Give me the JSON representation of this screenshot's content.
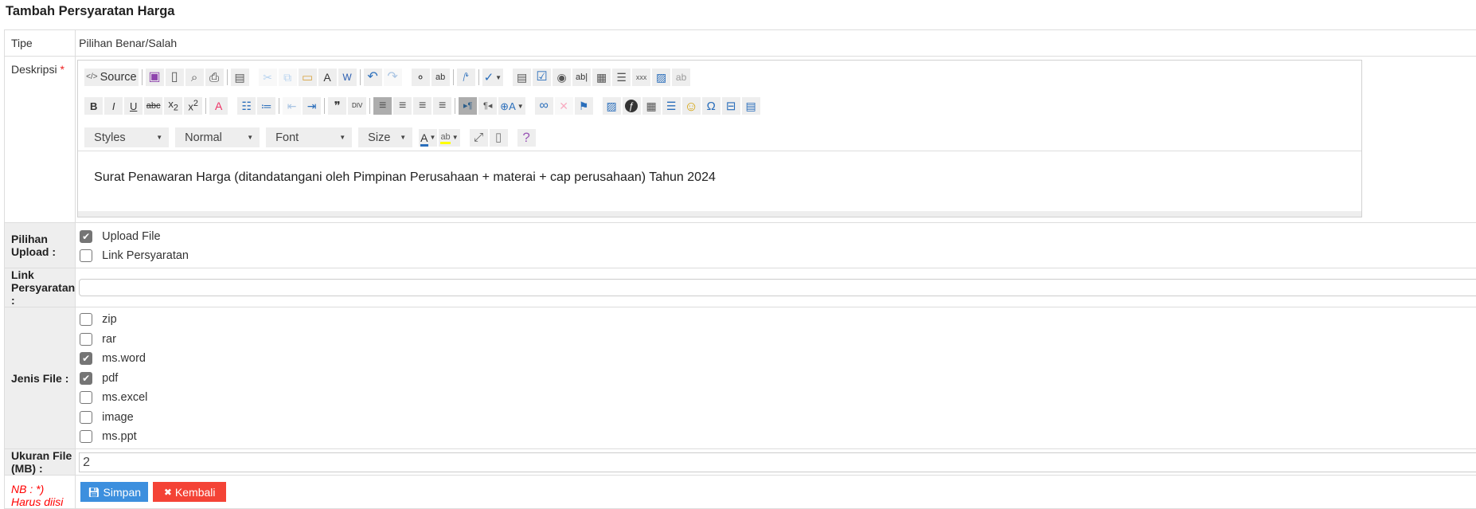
{
  "title": "Tambah Persyaratan Harga",
  "rows": {
    "tipe": {
      "label": "Tipe",
      "value": "Pilihan Benar/Salah"
    },
    "deskripsi": {
      "label": "Deskripsi",
      "required_mark": "*"
    },
    "pilihan_upload": {
      "label": "Pilihan Upload :",
      "options": [
        {
          "label": "Upload File",
          "checked": true
        },
        {
          "label": "Link Persyaratan",
          "checked": false
        }
      ]
    },
    "link_persyaratan": {
      "label": "Link Persyaratan :",
      "selected": ""
    },
    "jenis_file": {
      "label": "Jenis File :",
      "options": [
        {
          "label": "zip",
          "checked": false
        },
        {
          "label": "rar",
          "checked": false
        },
        {
          "label": "ms.word",
          "checked": true
        },
        {
          "label": "pdf",
          "checked": true
        },
        {
          "label": "ms.excel",
          "checked": false
        },
        {
          "label": "image",
          "checked": false
        },
        {
          "label": "ms.ppt",
          "checked": false
        }
      ]
    },
    "ukuran_file": {
      "label": "Ukuran File (MB) :",
      "value": "2"
    },
    "note": "NB : *) Harus diisi"
  },
  "editor": {
    "content": "Surat Penawaran Harga (ditandatangani oleh Pimpinan Perusahaan + materai + cap perusahaan) Tahun  2024",
    "toolbar": {
      "row1": [
        "source",
        "|",
        "save",
        "newpage",
        "preview",
        "print",
        "|",
        "templates",
        " ",
        "cut!",
        "copy!",
        "paste",
        "pastetext",
        "pasteword",
        "|",
        "undo",
        "redo!",
        " ",
        "find",
        "replace",
        "|",
        "selectall",
        "|",
        "spellcheck",
        " ",
        "form",
        "checkbox",
        "radio",
        "textfield",
        "textarea",
        "select",
        "button",
        "imagebutton",
        "hiddenfield"
      ],
      "row2": [
        "bold",
        "italic",
        "underline",
        "strike",
        "subscript",
        "superscript",
        "|",
        "removeformat",
        " ",
        "numberedlist",
        "bulletedlist",
        "|",
        "outdent!",
        "indent",
        "|",
        "blockquote",
        "creatediv",
        "|",
        "alignleft*",
        "aligncenter",
        "alignright",
        "alignjustify",
        "|",
        "bidiltr*",
        "bidirtl",
        "language",
        " ",
        "link",
        "unlink!",
        "anchor",
        " ",
        "image",
        "flash",
        "table",
        "horizontalrule",
        "smiley",
        "specialchar",
        "pagebreak",
        "iframe"
      ],
      "row3_tools": [
        "textcolor",
        "bgcolor",
        " ",
        "maximize",
        "showblocks",
        " ",
        "about"
      ],
      "source_label": "Source",
      "combos": [
        "Styles",
        "Normal",
        "Font",
        "Size"
      ]
    }
  },
  "buttons": {
    "save": "Simpan",
    "back": "Kembali"
  },
  "colors": {
    "save": "#3c8fde",
    "back": "#f44336",
    "required": "#e22222",
    "label_bg": "#eeeeee"
  }
}
